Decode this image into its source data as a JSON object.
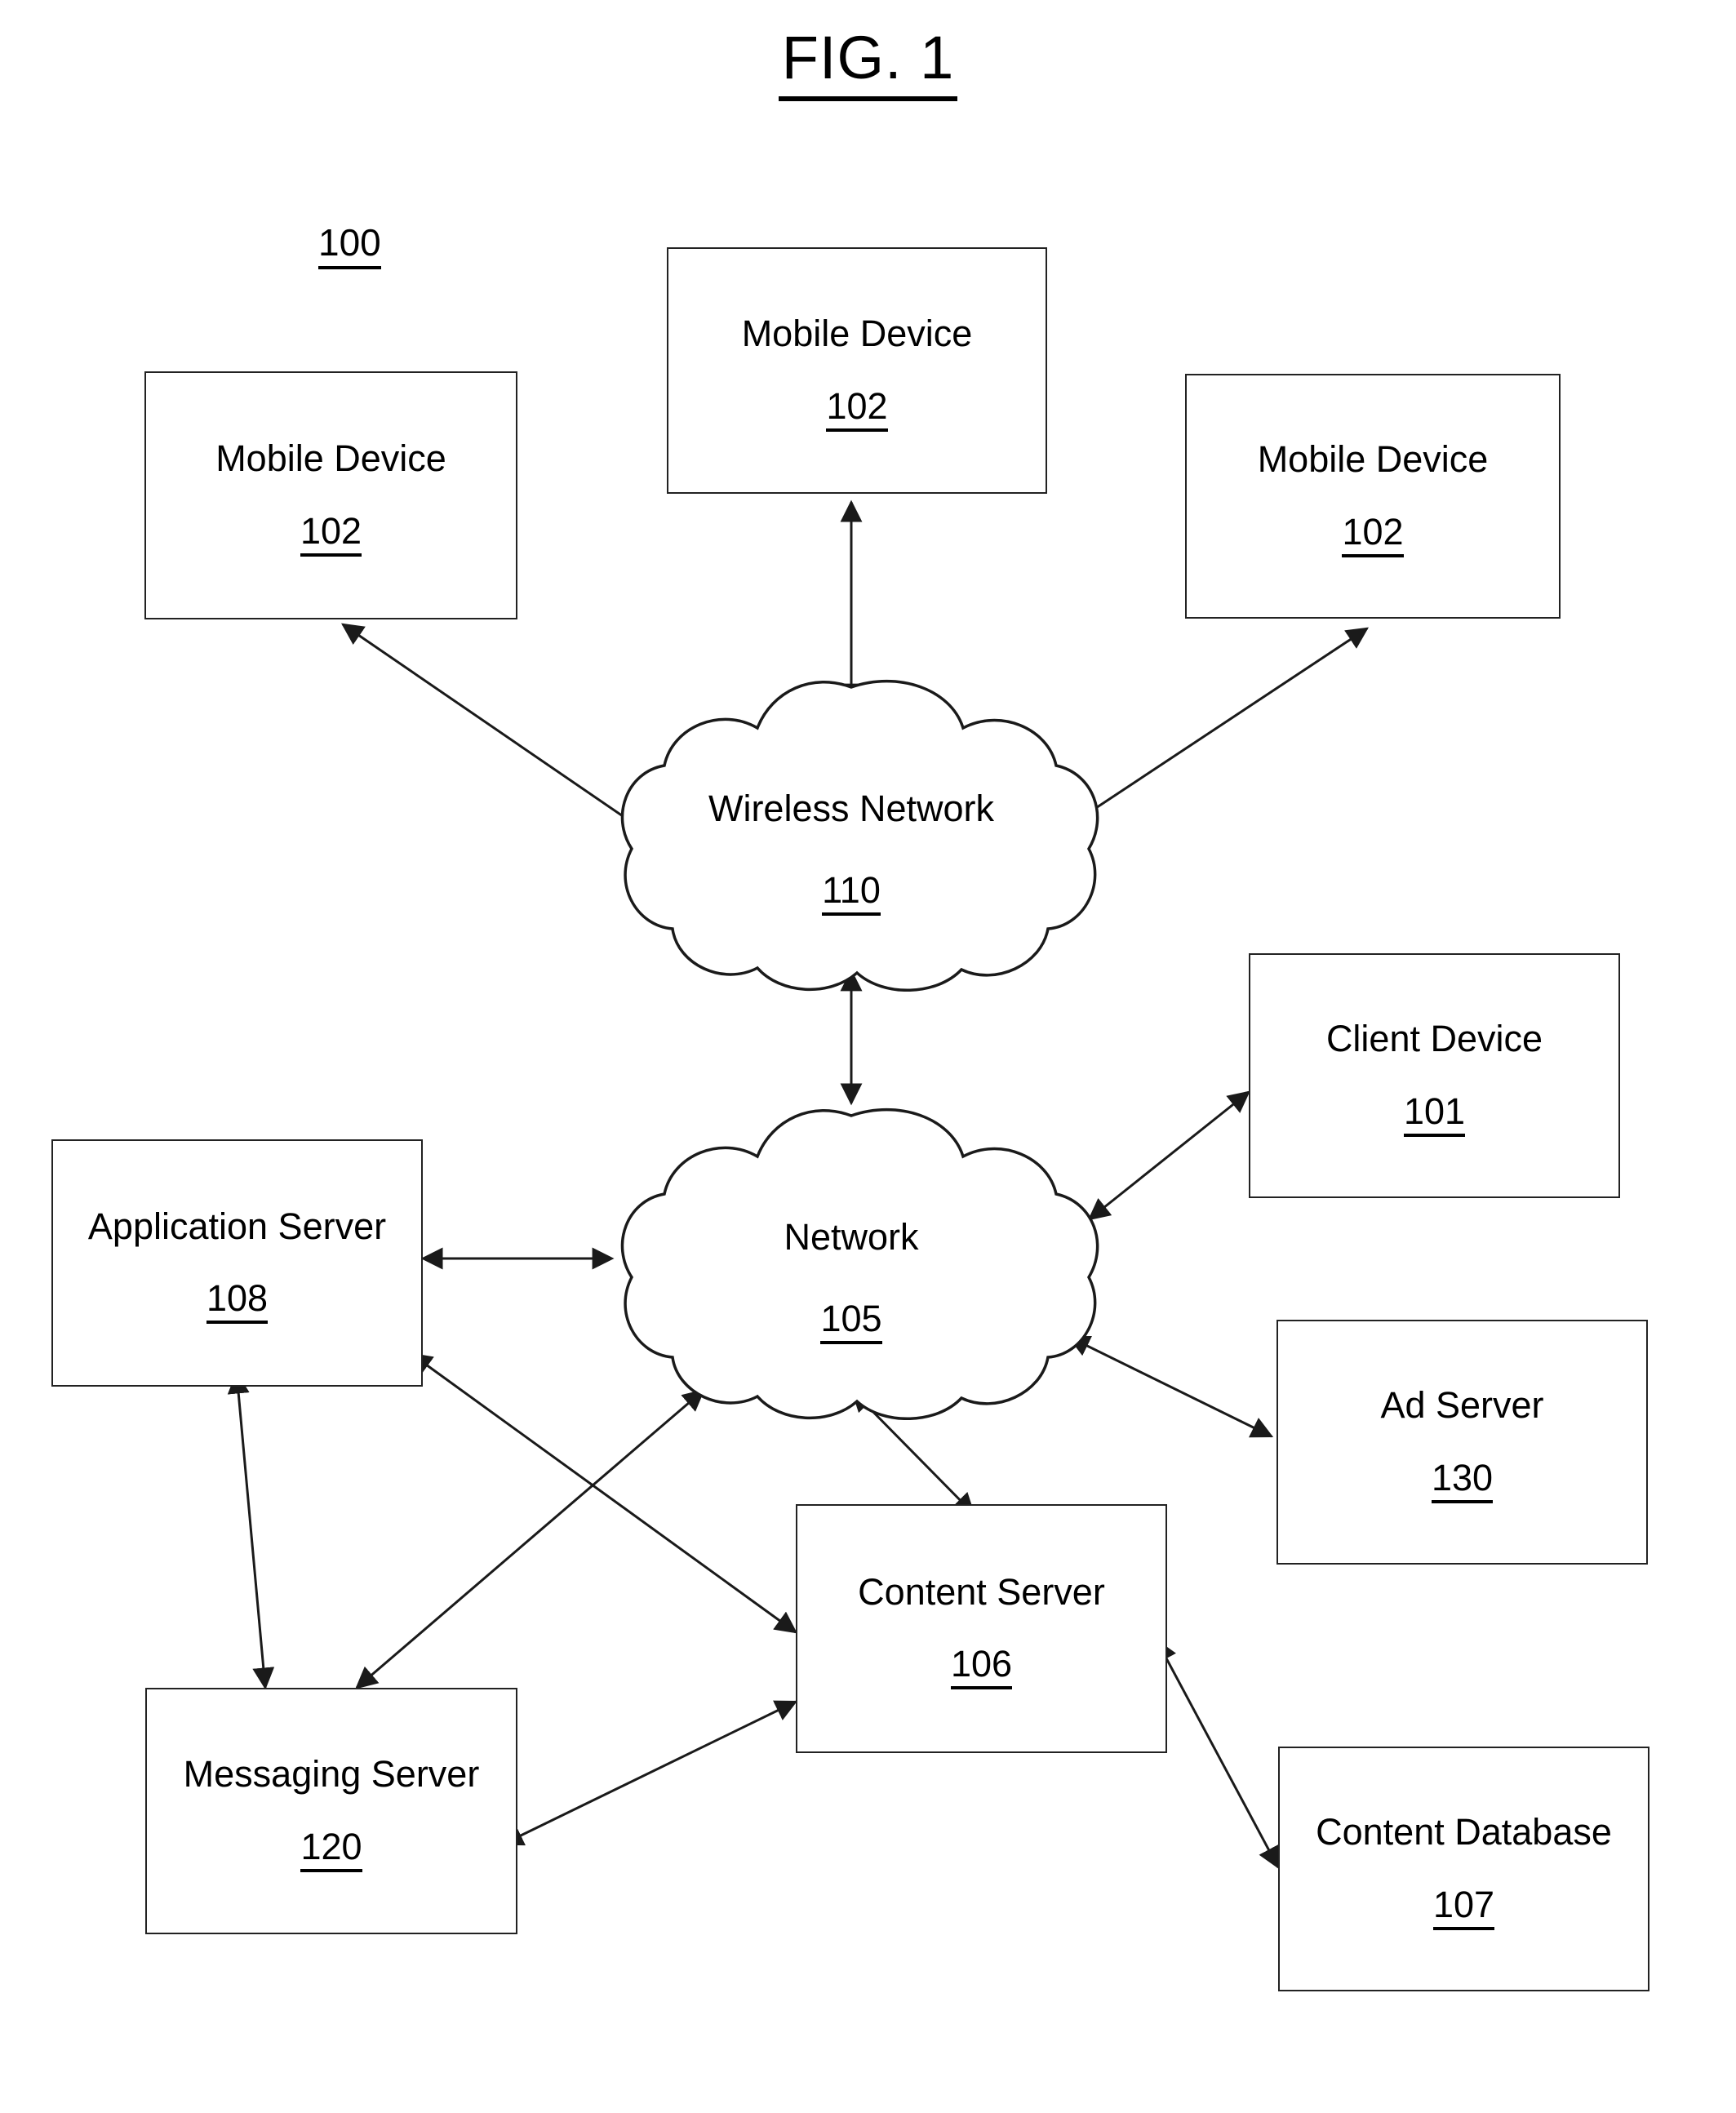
{
  "figure": {
    "title": "FIG. 1",
    "system_ref": "100"
  },
  "nodes": [
    {
      "id": "mobile-device-left",
      "label": "Mobile Device",
      "ref": "102"
    },
    {
      "id": "mobile-device-top",
      "label": "Mobile Device",
      "ref": "102"
    },
    {
      "id": "mobile-device-right",
      "label": "Mobile Device",
      "ref": "102"
    },
    {
      "id": "wireless-network",
      "label": "Wireless Network",
      "ref": "110"
    },
    {
      "id": "network",
      "label": "Network",
      "ref": "105"
    },
    {
      "id": "client-device",
      "label": "Client Device",
      "ref": "101"
    },
    {
      "id": "ad-server",
      "label": "Ad Server",
      "ref": "130"
    },
    {
      "id": "application-server",
      "label": "Application Server",
      "ref": "108"
    },
    {
      "id": "content-server",
      "label": "Content Server",
      "ref": "106"
    },
    {
      "id": "content-database",
      "label": "Content Database",
      "ref": "107"
    },
    {
      "id": "messaging-server",
      "label": "Messaging Server",
      "ref": "120"
    }
  ],
  "connections": [
    {
      "from": "wireless-network",
      "to": "mobile-device-left",
      "arrows": "both"
    },
    {
      "from": "wireless-network",
      "to": "mobile-device-top",
      "arrows": "both"
    },
    {
      "from": "wireless-network",
      "to": "mobile-device-right",
      "arrows": "both"
    },
    {
      "from": "wireless-network",
      "to": "network",
      "arrows": "both"
    },
    {
      "from": "network",
      "to": "client-device",
      "arrows": "both"
    },
    {
      "from": "network",
      "to": "ad-server",
      "arrows": "both"
    },
    {
      "from": "network",
      "to": "application-server",
      "arrows": "both"
    },
    {
      "from": "network",
      "to": "content-server",
      "arrows": "both"
    },
    {
      "from": "network",
      "to": "messaging-server",
      "arrows": "both"
    },
    {
      "from": "application-server",
      "to": "messaging-server",
      "arrows": "both"
    },
    {
      "from": "application-server",
      "to": "content-server",
      "arrows": "both"
    },
    {
      "from": "messaging-server",
      "to": "content-server",
      "arrows": "both"
    },
    {
      "from": "content-server",
      "to": "content-database",
      "arrows": "both"
    }
  ],
  "style": {
    "line_color": "#1a1a1a",
    "box_border_color": "#222222",
    "background": "#ffffff"
  }
}
